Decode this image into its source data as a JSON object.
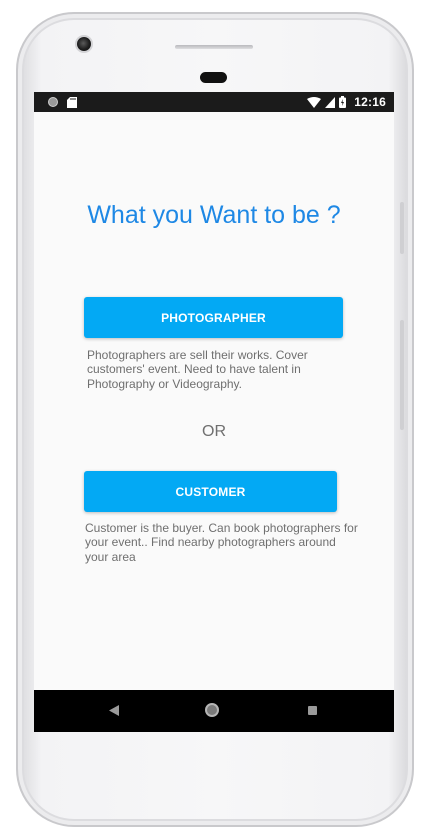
{
  "status_bar": {
    "time": "12:16",
    "icons": [
      "notification-dot-icon",
      "sd-card-icon",
      "wifi-icon",
      "cell-signal-icon",
      "battery-icon"
    ]
  },
  "screen": {
    "headline": "What you Want to be ?",
    "photographer_button": "PHOTOGRAPHER",
    "photographer_description": "Photographers are sell their works. Cover customers' event. Need to have talent in Photography or Videography.",
    "or_label": "OR",
    "customer_button": "CUSTOMER",
    "customer_description": "Customer is the buyer. Can book photographers for your  event.. Find nearby photographers around your area"
  },
  "nav_bar": {
    "icons": [
      "back-icon",
      "home-icon",
      "recent-apps-icon"
    ]
  },
  "colors": {
    "accent": "#03a9f4",
    "headline": "#1e88e5",
    "body_text": "#6f6f6f",
    "background": "#fafafa"
  }
}
